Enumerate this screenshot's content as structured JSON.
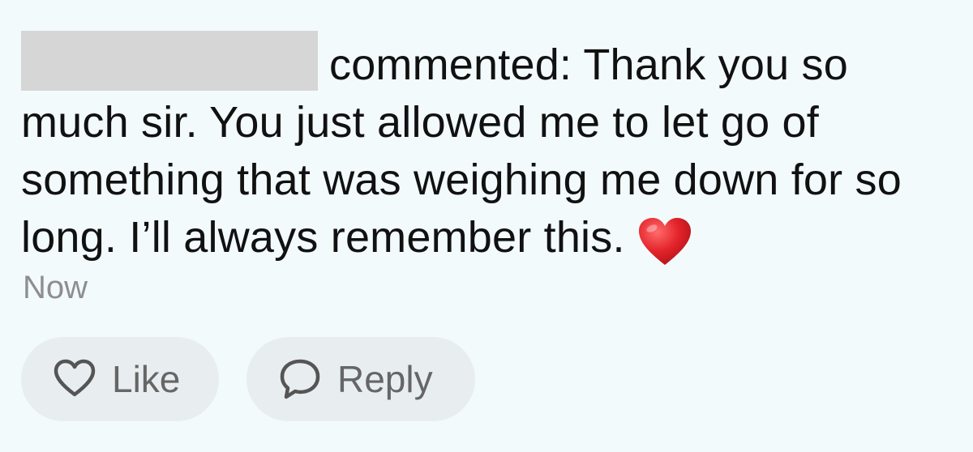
{
  "comment": {
    "action_text": "commented:",
    "line1_text": "Thank you so",
    "body_rest": "much sir. You just allowed me to let go of something that was weighing me down for so long. I’ll always remember this.",
    "emoji": "red-heart-icon",
    "timestamp": "Now"
  },
  "actions": {
    "like_label": "Like",
    "reply_label": "Reply"
  },
  "colors": {
    "background": "#f3fafc",
    "redaction": "#d6d6d6",
    "button_bg": "#e8eef0",
    "timestamp": "#8e8e8e",
    "heart": "#e3242b"
  }
}
